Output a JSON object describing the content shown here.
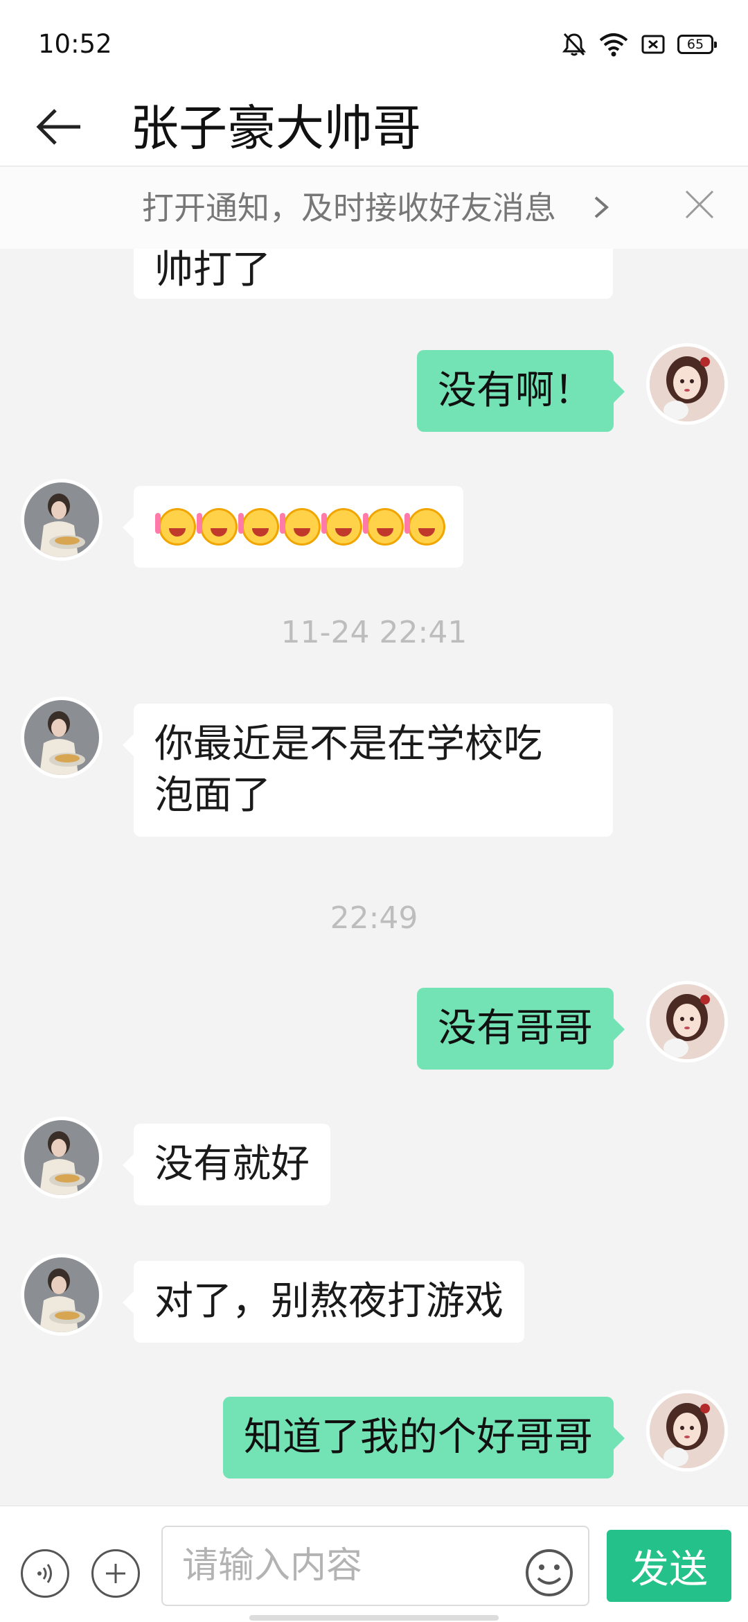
{
  "status_bar": {
    "time": "10:52",
    "battery": "65"
  },
  "header": {
    "title": "张子豪大帅哥"
  },
  "notify_banner": {
    "text": "打开通知，及时接收好友消息"
  },
  "messages": [
    {
      "side": "left",
      "text": "帅打了"
    },
    {
      "side": "right",
      "text": "没有啊！"
    },
    {
      "side": "left",
      "emoji": "laughing-face",
      "emoji_count": 7
    },
    {
      "timestamp": "11-24 22:41"
    },
    {
      "side": "left",
      "lines": [
        "你最近是不是在学校吃",
        "泡面了"
      ]
    },
    {
      "timestamp": "22:49"
    },
    {
      "side": "right",
      "text": "没有哥哥"
    },
    {
      "side": "left",
      "text": "没有就好"
    },
    {
      "side": "left",
      "text": "对了，别熬夜打游戏"
    },
    {
      "side": "right",
      "text": "知道了我的个好哥哥"
    }
  ],
  "input_bar": {
    "placeholder": "请输入内容",
    "send_label": "发送"
  },
  "colors": {
    "my_bubble": "#73e2b5",
    "send_button": "#25c18b",
    "background": "#f3f3f3"
  }
}
